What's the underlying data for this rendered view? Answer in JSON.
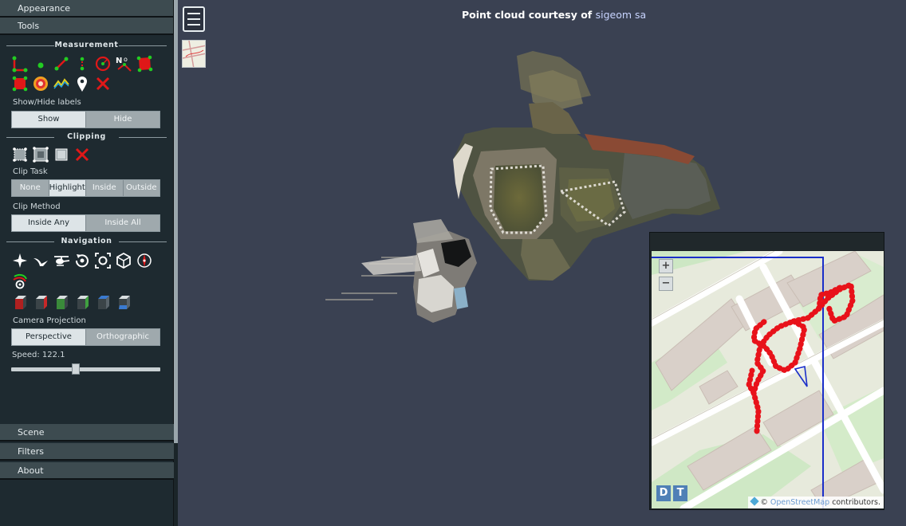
{
  "sidebar": {
    "appearance_label": "Appearance",
    "tools_label": "Tools",
    "measurement": {
      "title": "Measurement",
      "show_hide_label": "Show/Hide labels",
      "show_label": "Show",
      "hide_label": "Hide"
    },
    "clipping": {
      "title": "Clipping",
      "clip_task_label": "Clip Task",
      "clip_task_options": [
        "None",
        "Highlight",
        "Inside",
        "Outside"
      ],
      "clip_task_selected": "Highlight",
      "clip_method_label": "Clip Method",
      "clip_method_options": [
        "Inside Any",
        "Inside All"
      ],
      "clip_method_selected": "Inside Any"
    },
    "navigation": {
      "title": "Navigation",
      "camera_projection_label": "Camera Projection",
      "projection_options": [
        "Perspective",
        "Orthographic"
      ],
      "projection_selected": "Perspective",
      "speed_label": "Speed: 122.1",
      "speed_fraction": 0.43
    },
    "scene_label": "Scene",
    "filters_label": "Filters",
    "about_label": "About"
  },
  "viewer": {
    "credit_prefix": "Point cloud courtesy of ",
    "credit_link": "sigeom sa"
  },
  "map": {
    "zoom_in": "+",
    "zoom_out": "−",
    "d_button": "D",
    "t_button": "T",
    "attribution_copy": "©",
    "attribution_link": "OpenStreetMap",
    "attribution_suffix": " contributors."
  },
  "colors": {
    "sidebar_bg": "#1e2a30",
    "viewer_bg": "#3a4152",
    "track_red": "#e8121a",
    "frustum_blue": "#1a2ec9"
  }
}
